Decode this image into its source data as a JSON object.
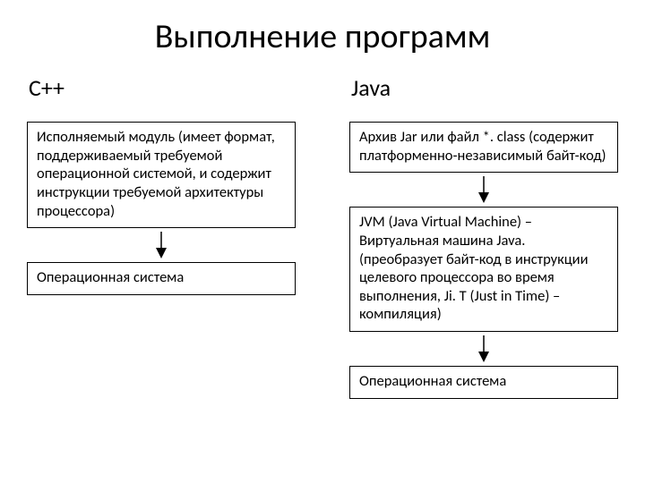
{
  "title": "Выполнение программ",
  "left": {
    "header": "C++",
    "box1": "Исполняемый модуль (имеет формат, поддерживаемый требуемой операционной системой, и содержит инструкции требуемой архитектуры процессора)",
    "box2": "Операционная система"
  },
  "right": {
    "header": "Java",
    "box1": "Архив Jar или файл *. class (содержит платформенно-независимый байт-код)",
    "box2": "JVM (Java Virtual Machine) – Виртуальная машина Java. (преобразует байт-код в инструкции целевого процессора во время выполнения, Ji. T (Just in Time) –компиляция)",
    "box3": "Операционная система"
  }
}
